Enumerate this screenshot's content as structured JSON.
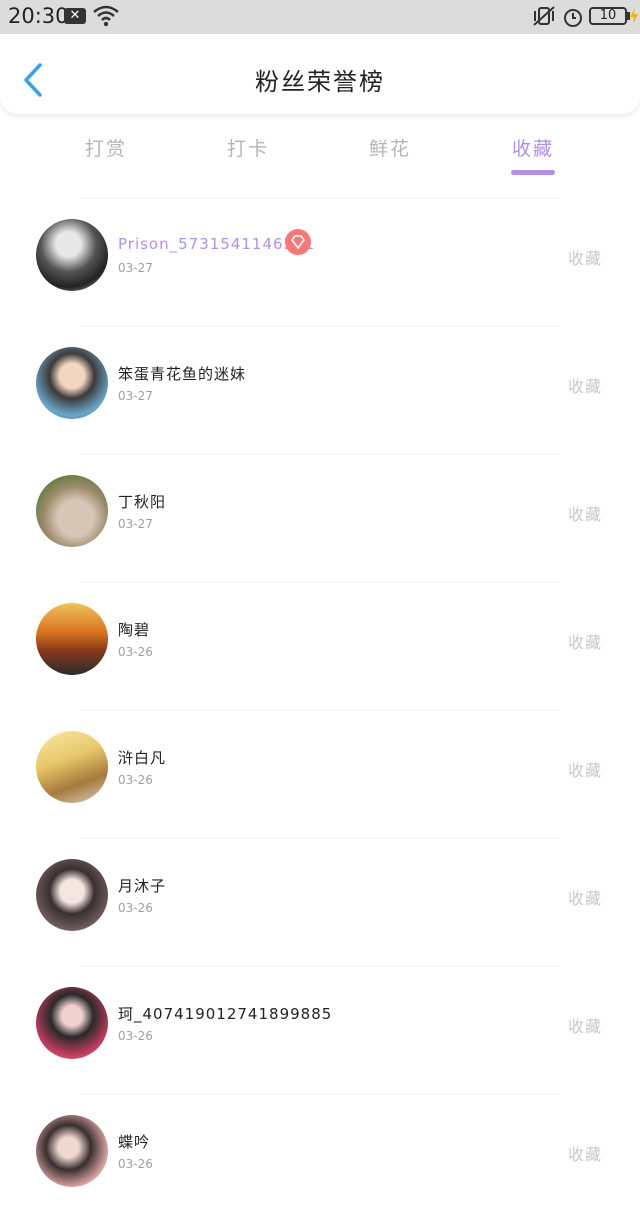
{
  "status_bar": {
    "time": "20:30",
    "notification_icon": "x-box-icon",
    "battery_level": "10"
  },
  "header": {
    "title": "粉丝荣誉榜",
    "back_icon": "chevron-left-icon"
  },
  "tabs": [
    {
      "label": "打赏",
      "active": false
    },
    {
      "label": "打卡",
      "active": false
    },
    {
      "label": "鲜花",
      "active": false
    },
    {
      "label": "收藏",
      "active": true
    }
  ],
  "colors": {
    "accent": "#b48fe6",
    "badge": "#f47a7a",
    "muted_text": "#c8c8c8"
  },
  "fans": [
    {
      "name": "Prison_5731541146371",
      "date": "03-27",
      "action": "收藏",
      "vip": true
    },
    {
      "name": "笨蛋青花鱼的迷妹",
      "date": "03-27",
      "action": "收藏",
      "vip": false
    },
    {
      "name": "丁秋阳",
      "date": "03-27",
      "action": "收藏",
      "vip": false
    },
    {
      "name": "陶碧",
      "date": "03-26",
      "action": "收藏",
      "vip": false
    },
    {
      "name": "浒白凡",
      "date": "03-26",
      "action": "收藏",
      "vip": false
    },
    {
      "name": "月沐子",
      "date": "03-26",
      "action": "收藏",
      "vip": false
    },
    {
      "name": "珂_407419012741899885",
      "date": "03-26",
      "action": "收藏",
      "vip": false
    },
    {
      "name": "蝶吟",
      "date": "03-26",
      "action": "收藏",
      "vip": false
    }
  ]
}
